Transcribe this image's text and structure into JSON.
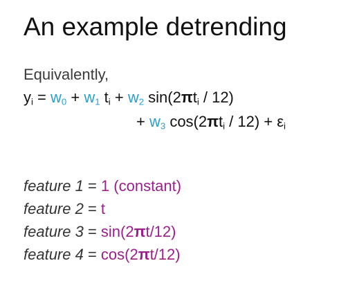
{
  "slide": {
    "title": "An example detrending",
    "intro": "Equivalently,",
    "equation": {
      "y": "y",
      "i": "i",
      "eq": " = ",
      "plus": " + ",
      "w0": "w",
      "w0_sub": "0",
      "w1": "w",
      "w1_sub": "1",
      "t1": " t",
      "t1_sub": "i",
      "w2": "w",
      "w2_sub": "2",
      "sin_a": " sin(2",
      "pi": "π",
      "sin_t": "t",
      "sin_t_sub": "i",
      "sin_b": " / 12)",
      "line2_plus": "+ ",
      "w3": "w",
      "w3_sub": "3",
      "cos_a": " cos(2",
      "cos_t": "t",
      "cos_t_sub": "i",
      "cos_b": " / 12) + ε",
      "eps_sub": "i"
    },
    "features": [
      {
        "name": "feature 1",
        "eq": " = ",
        "value": "1 (constant)"
      },
      {
        "name": "feature 2",
        "eq": " = ",
        "value": "t"
      },
      {
        "name": "feature 3",
        "eq": " = ",
        "value_a": "sin(2",
        "pi": "π",
        "value_b": "t/12)"
      },
      {
        "name": "feature 4",
        "eq": " = ",
        "value_a": "cos(2",
        "pi": "π",
        "value_b": "t/12)"
      }
    ],
    "colors": {
      "weight": "#2aa0c8",
      "feature_value": "#9b1f8a",
      "text": "#111111"
    }
  }
}
